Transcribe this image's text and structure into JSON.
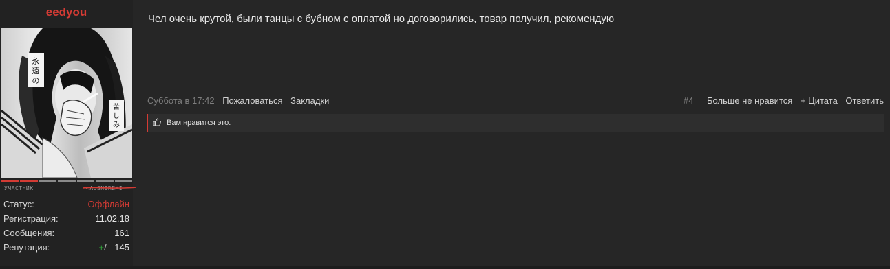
{
  "user": {
    "name": "eedyou",
    "rank_left": "УЧАСТНИК",
    "rank_right": "<AUSNIREXI",
    "rank_bar": {
      "filled": 2,
      "total": 7
    },
    "info": [
      {
        "label": "Статус:",
        "value": "Оффлайн"
      },
      {
        "label": "Регистрация:",
        "value": "11.02.18"
      },
      {
        "label": "Сообщения:",
        "value": "161"
      }
    ],
    "reputation": {
      "label": "Репутация:",
      "plus": "+",
      "slash": "/",
      "minus": "-",
      "value": "145"
    },
    "avatar_text": {
      "top": "永遠の",
      "side": "苦しみ"
    }
  },
  "post": {
    "message": "Чел очень крутой, были танцы с бубном с оплатой но договорились, товар получил, рекомендую",
    "date": "Суббота в 17:42",
    "report": "Пожаловаться",
    "bookmarks": "Закладки",
    "number": "#4",
    "unlike": "Больше не нравится",
    "quote": "+ Цитата",
    "reply": "Ответить",
    "likes_text": "Вам нравится это.",
    "like_icon": "thumbs-up-icon"
  },
  "colors": {
    "accent": "#d43b34",
    "background": "#262626",
    "sidebar": "#222222",
    "positive": "#2fa83a"
  }
}
